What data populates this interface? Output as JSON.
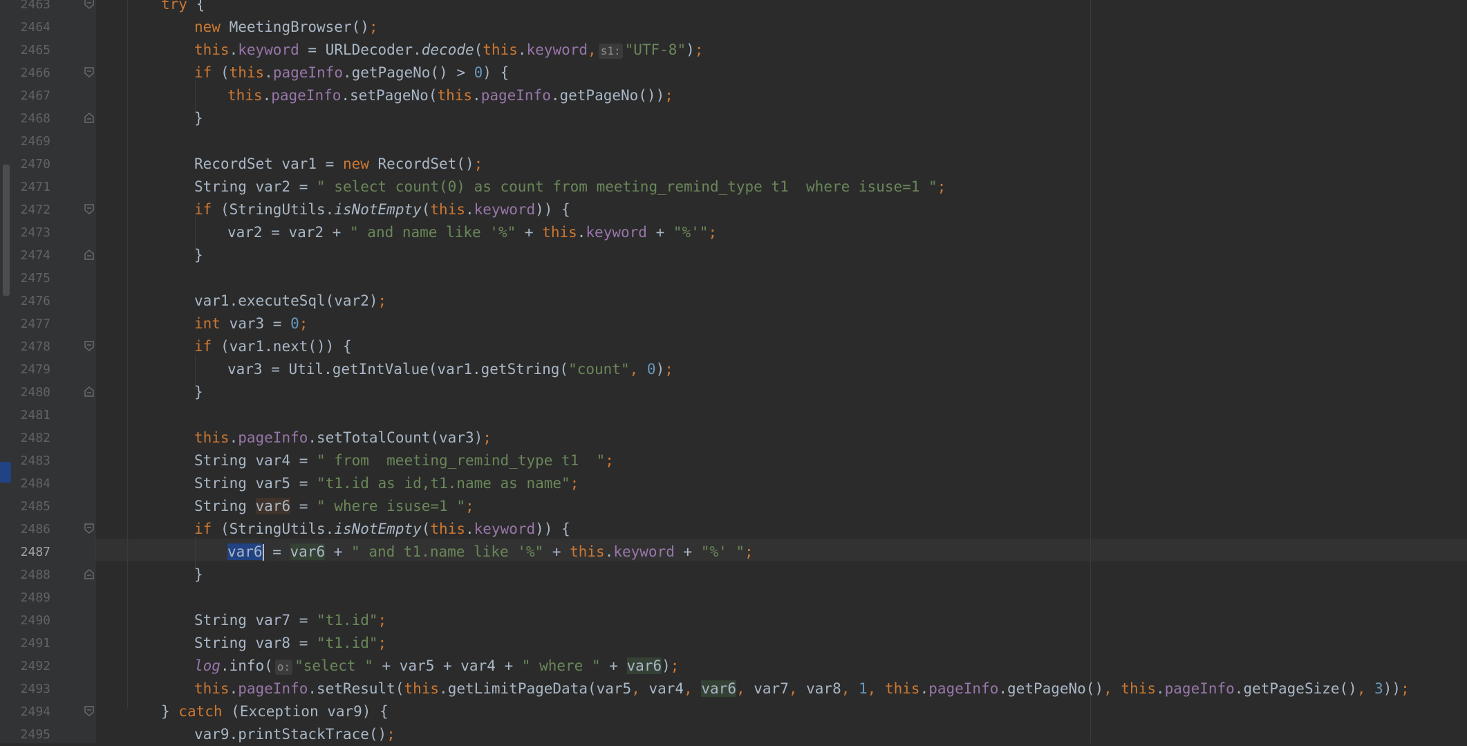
{
  "editor": {
    "language": "Java",
    "current_line": "2487",
    "line_numbers": [
      "2463",
      "2464",
      "2465",
      "2466",
      "2467",
      "2468",
      "2469",
      "2470",
      "2471",
      "2472",
      "2473",
      "2474",
      "2475",
      "2476",
      "2477",
      "2478",
      "2479",
      "2480",
      "2481",
      "2482",
      "2483",
      "2484",
      "2485",
      "2486",
      "2487",
      "2488",
      "2489",
      "2490",
      "2491",
      "2492",
      "2493",
      "2494",
      "2495"
    ],
    "code": {
      "l2463": {
        "kw": "try",
        "p": " {"
      },
      "l2464": {
        "kw": "new",
        "p1": " MeetingBrowser()",
        "semi": ";"
      },
      "l2465": {
        "this1": "this",
        "dot1": ".",
        "field1": "keyword",
        "p1": " = URLDecoder.",
        "method": "decode",
        "p2": "(",
        "this2": "this",
        "dot2": ".",
        "field2": "keyword",
        "comma": ",",
        "hint": "s1:",
        "str": "\"UTF-8\"",
        "p3": ")",
        "semi": ";"
      },
      "l2466": {
        "kw": "if",
        "p1": " (",
        "this": "this",
        "dot": ".",
        "field": "pageInfo",
        "p2": ".getPageNo() > ",
        "num": "0",
        "p3": ") {"
      },
      "l2467": {
        "this1": "this",
        "dot1": ".",
        "field1": "pageInfo",
        "p1": ".setPageNo(",
        "this2": "this",
        "dot2": ".",
        "field2": "pageInfo",
        "p2": ".getPageNo())",
        "semi": ";"
      },
      "l2468": {
        "p": "}"
      },
      "l2470": {
        "p1": "RecordSet var1 = ",
        "kw": "new",
        "p2": " RecordSet()",
        "semi": ";"
      },
      "l2471": {
        "p1": "String var2 = ",
        "str": "\" select count(0) as count from meeting_remind_type t1  where isuse=1 \"",
        "semi": ";"
      },
      "l2472": {
        "kw": "if",
        "p1": " (StringUtils.",
        "method": "isNotEmpty",
        "p2": "(",
        "this": "this",
        "dot": ".",
        "field": "keyword",
        "p3": ")) {"
      },
      "l2473": {
        "p1": "var2 = var2 + ",
        "str1": "\" and name like '%\"",
        "p2": " + ",
        "this": "this",
        "dot": ".",
        "field": "keyword",
        "p3": " + ",
        "str2": "\"%'\"",
        "semi": ";"
      },
      "l2474": {
        "p": "}"
      },
      "l2476": {
        "p1": "var1.executeSql(var2)",
        "semi": ";"
      },
      "l2477": {
        "kw": "int",
        "p1": " var3 = ",
        "num": "0",
        "semi": ";"
      },
      "l2478": {
        "kw": "if",
        "p1": " (var1.next()) {"
      },
      "l2479": {
        "p1": "var3 = Util.getIntValue(var1.getString(",
        "str": "\"count\"",
        "comma": ",",
        "num": " 0",
        "p2": ")",
        "semi": ";"
      },
      "l2480": {
        "p": "}"
      },
      "l2482": {
        "this": "this",
        "dot": ".",
        "field": "pageInfo",
        "p1": ".setTotalCount(var3)",
        "semi": ";"
      },
      "l2483": {
        "p1": "String var4 = ",
        "str": "\" from  meeting_remind_type t1  \"",
        "semi": ";"
      },
      "l2484": {
        "p1": "String var5 = ",
        "str": "\"t1.id as id,t1.name as name\"",
        "semi": ";"
      },
      "l2485": {
        "p1": "String ",
        "var": "var6",
        "p2": " = ",
        "str": "\" where isuse=1 \"",
        "semi": ";"
      },
      "l2486": {
        "kw": "if",
        "p1": " (StringUtils.",
        "method": "isNotEmpty",
        "p2": "(",
        "this": "this",
        "dot": ".",
        "field": "keyword",
        "p3": ")) {"
      },
      "l2487": {
        "var1": "var6",
        "p1": " = ",
        "var2": "var6",
        "p2": " + ",
        "str1": "\" and t1.name like '%\"",
        "p3": " + ",
        "this": "this",
        "dot": ".",
        "field": "keyword",
        "p4": " + ",
        "str2": "\"%' \"",
        "semi": ";"
      },
      "l2488": {
        "p": "}"
      },
      "l2490": {
        "p1": "String var7 = ",
        "str": "\"t1.id\"",
        "semi": ";"
      },
      "l2491": {
        "p1": "String var8 = ",
        "str": "\"t1.id\"",
        "semi": ";"
      },
      "l2492": {
        "log": "log",
        "p1": ".info(",
        "hint": "o:",
        "str1": "\"select \"",
        "p2": " + var5 + var4 + ",
        "str2": "\" where \"",
        "p3": " + ",
        "var": "var6",
        "p4": ")",
        "semi": ";"
      },
      "l2493": {
        "this1": "this",
        "dot1": ".",
        "field1": "pageInfo",
        "p1": ".setResult(",
        "this2": "this",
        "p2": ".getLimitPageData(var5",
        "c1": ",",
        "p3": " var4",
        "c2": ",",
        "var": "var6",
        "c3": ",",
        "p4": " var7",
        "c4": ",",
        "p5": " var8",
        "c5": ",",
        "num1": " 1",
        "c6": ",",
        "this3": "this",
        "dot3": ".",
        "field3": "pageInfo",
        "p6": ".getPageNo()",
        "c7": ",",
        "this4": "this",
        "dot4": ".",
        "field4": "pageInfo",
        "p7": ".getPageSize()",
        "c8": ",",
        "num2": " 3",
        "p8": "))",
        "semi": ";"
      },
      "l2494": {
        "p1": "} ",
        "kw": "catch",
        "p2": " (Exception var9) {"
      },
      "l2495": {
        "p1": "var9.printStackTrace()",
        "semi": ";"
      }
    }
  },
  "colors": {
    "background": "#2b2b2b",
    "gutter": "#313335",
    "keyword": "#cc7832",
    "field": "#9876aa",
    "string": "#6a8759",
    "number": "#6897bb",
    "text": "#a9b7c6",
    "selection": "#214283"
  },
  "icons": {
    "fold_start": "fold-start-icon",
    "fold_end": "fold-end-icon"
  }
}
